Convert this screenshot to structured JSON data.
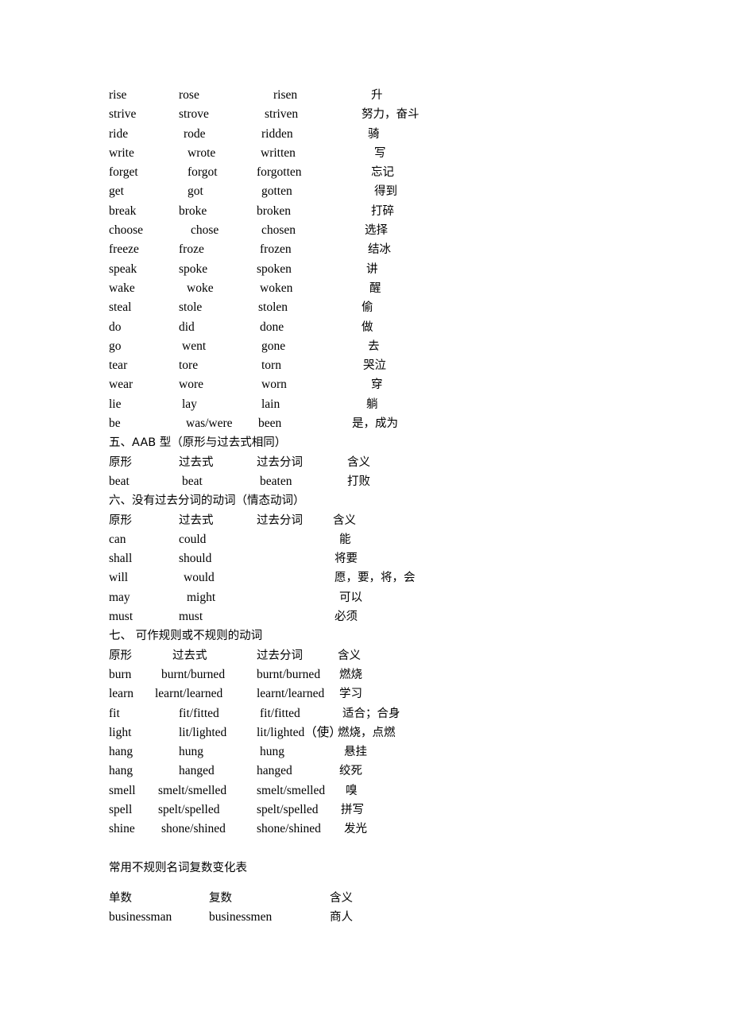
{
  "document": {
    "column_headers": {
      "base": "原形",
      "past": "过去式",
      "participle": "过去分词",
      "meaning": "含义"
    },
    "noun_headers": {
      "singular": "单数",
      "plural": "复数",
      "meaning": "含义"
    },
    "noun_table_title": "常用不规则名词复数变化表"
  },
  "section_abc_continued": {
    "rows": [
      {
        "base": "rise",
        "past": "rose",
        "participle": "risen",
        "meaning": "升"
      },
      {
        "base": "strive",
        "past": "strove",
        "participle": "striven",
        "meaning": "努力，奋斗"
      },
      {
        "base": "ride",
        "past": "rode",
        "participle": "ridden",
        "meaning": "骑"
      },
      {
        "base": "write",
        "past": "wrote",
        "participle": "written",
        "meaning": "写"
      },
      {
        "base": "forget",
        "past": "forgot",
        "participle": "forgotten",
        "meaning": "忘记"
      },
      {
        "base": "get",
        "past": "got",
        "participle": "gotten",
        "meaning": "得到"
      },
      {
        "base": "break",
        "past": "broke",
        "participle": "broken",
        "meaning": "打碎"
      },
      {
        "base": "choose",
        "past": "chose",
        "participle": "chosen",
        "meaning": "选择"
      },
      {
        "base": "freeze",
        "past": "froze",
        "participle": "frozen",
        "meaning": "结冰"
      },
      {
        "base": "speak",
        "past": "spoke",
        "participle": "spoken",
        "meaning": "讲"
      },
      {
        "base": "wake",
        "past": "woke",
        "participle": "woken",
        "meaning": "醒"
      },
      {
        "base": "steal",
        "past": "stole",
        "participle": "stolen",
        "meaning": "偷"
      },
      {
        "base": "do",
        "past": "did",
        "participle": "done",
        "meaning": "做"
      },
      {
        "base": "go",
        "past": "went",
        "participle": "gone",
        "meaning": "去"
      },
      {
        "base": "tear",
        "past": "tore",
        "participle": "torn",
        "meaning": "哭泣"
      },
      {
        "base": "wear",
        "past": "wore",
        "participle": "worn",
        "meaning": "穿"
      },
      {
        "base": "lie",
        "past": "lay",
        "participle": "lain",
        "meaning": "躺"
      },
      {
        "base": "be",
        "past": "was/were",
        "participle": "been",
        "meaning": "是，成为"
      }
    ]
  },
  "section_five": {
    "title": "五、AAB 型（原形与过去式相同）",
    "rows": [
      {
        "base": "beat",
        "past": "beat",
        "participle": "beaten",
        "meaning": "打败"
      }
    ]
  },
  "section_six": {
    "title": "六、没有过去分词的动词（情态动词）",
    "rows": [
      {
        "base": "can",
        "past": "could",
        "participle": "",
        "meaning": "能"
      },
      {
        "base": "shall",
        "past": "should",
        "participle": "",
        "meaning": "将要"
      },
      {
        "base": "will",
        "past": "would",
        "participle": "",
        "meaning": "愿，要，将，会"
      },
      {
        "base": "may",
        "past": "might",
        "participle": "",
        "meaning": "可以"
      },
      {
        "base": "must",
        "past": "must",
        "participle": "",
        "meaning": "必须"
      }
    ]
  },
  "section_seven": {
    "title": "七、 可作规则或不规则的动词",
    "rows": [
      {
        "base": "burn",
        "past": "burnt/burned",
        "participle": "burnt/burned",
        "meaning": "燃烧"
      },
      {
        "base": "learn",
        "past": "learnt/learned",
        "participle": "learnt/learned",
        "meaning": "学习"
      },
      {
        "base": "fit",
        "past": "fit/fitted",
        "participle": "fit/fitted",
        "meaning": "适合；合身"
      },
      {
        "base": "light",
        "past": "lit/lighted",
        "participle": "lit/lighted（使）",
        "meaning": "燃烧，点燃"
      },
      {
        "base": "hang",
        "past": "hung",
        "participle": "hung",
        "meaning": "悬挂"
      },
      {
        "base": "hang",
        "past": "hanged",
        "participle": "hanged",
        "meaning": "绞死"
      },
      {
        "base": "smell",
        "past": "smelt/smelled",
        "participle": "smelt/smelled",
        "meaning": "嗅"
      },
      {
        "base": "spell",
        "past": "spelt/spelled",
        "participle": "spelt/spelled",
        "meaning": "拼写"
      },
      {
        "base": "shine",
        "past": "shone/shined",
        "participle": "shone/shined",
        "meaning": "发光"
      }
    ]
  },
  "noun_table": {
    "rows": [
      {
        "singular": "businessman",
        "plural": "businessmen",
        "meaning": "商人"
      }
    ]
  },
  "layout": {
    "main_cols": {
      "base": 0,
      "past": 88,
      "participle": 186,
      "meaning": 300
    },
    "modal_cols": {
      "base": 0,
      "past": 88,
      "participle": 186,
      "meaning": 282
    },
    "seven_cols": {
      "base": 0,
      "past": 66,
      "participle": 186,
      "meaning": 288
    },
    "noun_cols": {
      "singular": 0,
      "plural": 126,
      "meaning": 278
    }
  }
}
